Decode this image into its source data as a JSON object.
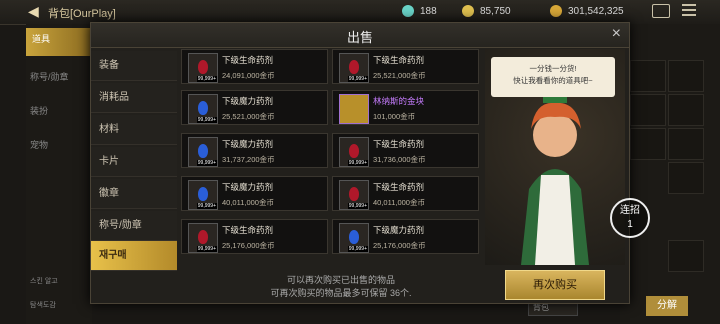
{
  "topbar": {
    "back_icon": "back-arrow-icon",
    "breadcrumb": "背包[OurPlay]",
    "currency1": "188",
    "currency2": "85,750",
    "currency3": "301,542,325"
  },
  "modal": {
    "title": "出售",
    "close": "×",
    "categories": [
      "装备",
      "消耗品",
      "材料",
      "卡片",
      "徽章",
      "称号/勋章",
      "재구매"
    ],
    "items": [
      {
        "name": "下级生命药剂",
        "price": "24,091,000金币",
        "qty": "99,999+",
        "type": "red"
      },
      {
        "name": "下级生命药剂",
        "price": "25,521,000金币",
        "qty": "99,999+",
        "type": "red"
      },
      {
        "name": "下级魔力药剂",
        "price": "25,521,000金币",
        "qty": "99,999+",
        "type": "blue"
      },
      {
        "name": "林纳斯的金块",
        "price": "101,000金币",
        "qty": "",
        "type": "gold"
      },
      {
        "name": "下级魔力药剂",
        "price": "31,737,200金币",
        "qty": "99,999+",
        "type": "blue"
      },
      {
        "name": "下级生命药剂",
        "price": "31,736,000金币",
        "qty": "99,999+",
        "type": "red"
      },
      {
        "name": "下级魔力药剂",
        "price": "40,011,000金币",
        "qty": "99,999+",
        "type": "blue"
      },
      {
        "name": "下级生命药剂",
        "price": "40,011,000金币",
        "qty": "99,999+",
        "type": "red"
      },
      {
        "name": "下级生命药剂",
        "price": "25,176,000金币",
        "qty": "99,999+",
        "type": "red"
      },
      {
        "name": "下级魔力药剂",
        "price": "25,176,000金币",
        "qty": "99,999+",
        "type": "blue"
      }
    ],
    "footer_line1": "可以再次购买已出售的物品",
    "footer_line2": "可再次购买的物品最多可保留 36个.",
    "rebuy_label": "再次购买",
    "npc_bubble_line1": "一分钱一分货!",
    "npc_bubble_line2": "快让我看看你的道具吧~"
  },
  "background": {
    "left_active": "道具",
    "left_items": [
      "称号/勋章",
      "装扮",
      "宠物"
    ],
    "bottom_item1": "스킨 알고",
    "bottom_item2": "탐색도감",
    "combo_label": "连招",
    "combo_count": "1",
    "sort_label": "背包",
    "sell_button": "分解"
  },
  "colors": {
    "accent": "#c9a43c",
    "red_potion": "#b0182a",
    "blue_potion": "#2a5ed8",
    "purple_name": "#c77dff"
  }
}
